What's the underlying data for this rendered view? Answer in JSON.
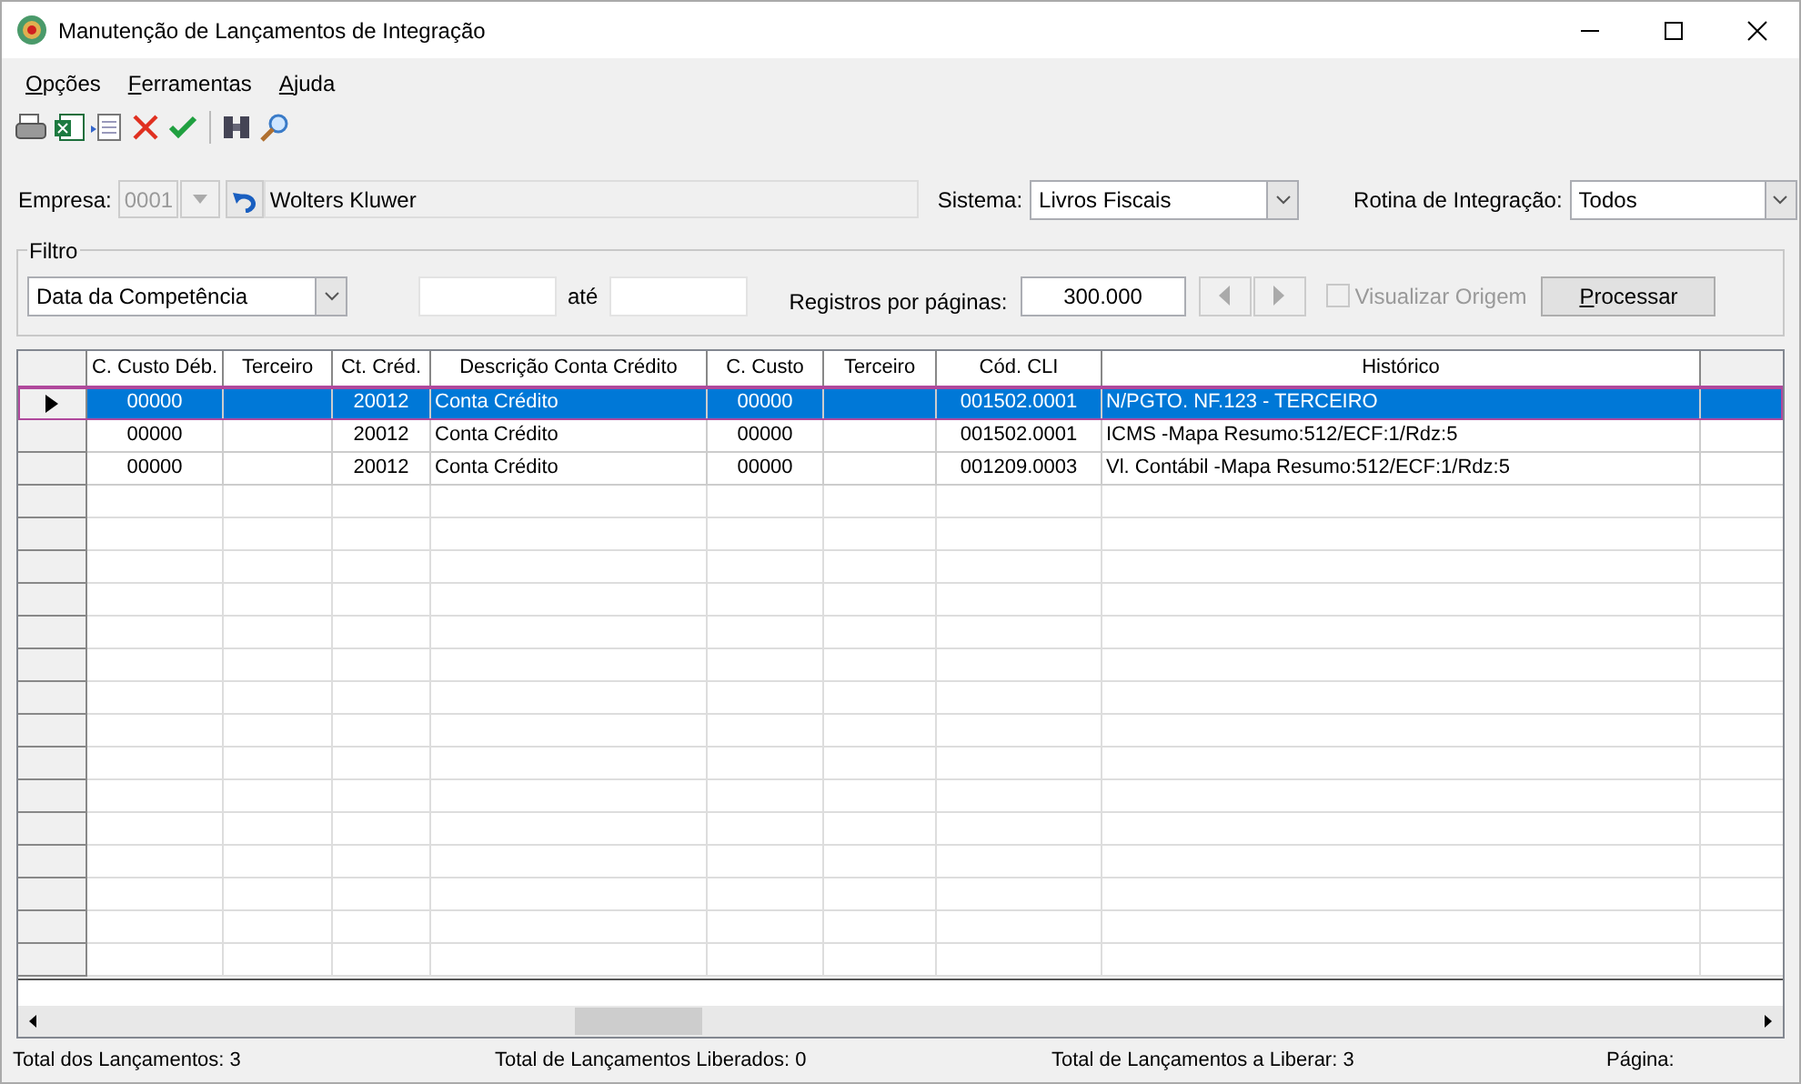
{
  "window": {
    "title": "Manutenção de Lançamentos de Integração"
  },
  "menu": [
    "Opções",
    "Ferramentas",
    "Ajuda"
  ],
  "empresa": {
    "label": "Empresa:",
    "code": "0001",
    "disabled": true,
    "name": "Wolters Kluwer"
  },
  "sistema": {
    "label": "Sistema:",
    "value": "Livros Fiscais"
  },
  "rotina": {
    "label": "Rotina de Integração:",
    "value": "Todos"
  },
  "filtro": {
    "title": "Filtro",
    "field": "Data da Competência",
    "until_label": "até",
    "per_page_label": "Registros por páginas:",
    "per_page": "300.000",
    "visualizar": {
      "label": "Visualizar Origem",
      "checked": false,
      "disabled": true
    },
    "button": "Processar"
  },
  "table": {
    "columns": [
      "C. Custo Déb.",
      "Terceiro",
      "Ct. Créd.",
      "Descrição Conta Crédito",
      "C. Custo",
      "Terceiro",
      "Cód. CLI",
      "Histórico"
    ],
    "rows": [
      {
        "selected": true,
        "cells": [
          "00000",
          "",
          "20012",
          "Conta Crédito",
          "00000",
          "",
          "001502.0001",
          "N/PGTO. NF.123 - TERCEIRO"
        ]
      },
      {
        "selected": false,
        "cells": [
          "00000",
          "",
          "20012",
          "Conta Crédito",
          "00000",
          "",
          "001502.0001",
          "ICMS -Mapa Resumo:512/ECF:1/Rdz:5"
        ]
      },
      {
        "selected": false,
        "cells": [
          "00000",
          "",
          "20012",
          "Conta Crédito",
          "00000",
          "",
          "001209.0003",
          "Vl. Contábil -Mapa Resumo:512/ECF:1/Rdz:5"
        ]
      }
    ]
  },
  "status_bar": [
    "Total dos Lançamentos: 3",
    "Total de Lançamentos Liberados: 0",
    "Total de Lançamentos a Liberar: 3",
    "Página:"
  ]
}
